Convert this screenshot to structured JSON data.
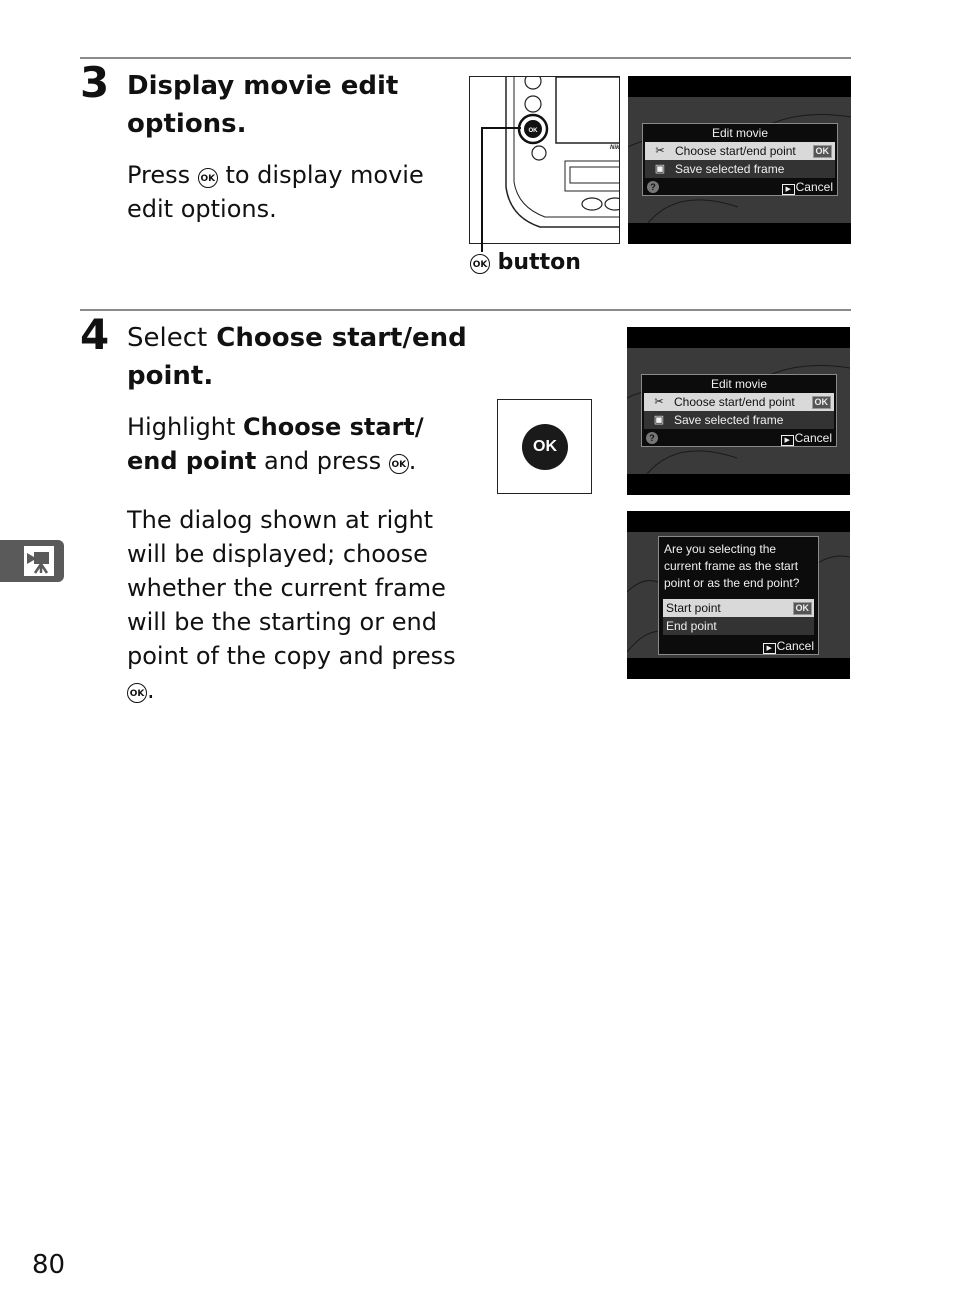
{
  "steps": [
    {
      "number": "3",
      "title": "Display movie edit options.",
      "body": {
        "before": "Press",
        "ok_symbol": "OK",
        "after": "to display movie edit options."
      },
      "figure_callout": {
        "ok_symbol": "OK",
        "label": "button"
      },
      "screen": {
        "title": "Edit movie",
        "items": [
          {
            "icon": "scissors-icon",
            "label": "Choose start/end point",
            "selected": true,
            "badge": "OK"
          },
          {
            "icon": "save-frame-icon",
            "label": "Save selected frame",
            "selected": false
          }
        ],
        "help": "?",
        "cancel": "Cancel"
      }
    },
    {
      "number": "4",
      "title_plain": "Select",
      "title_bold": "Choose start/end point",
      "title_end": ".",
      "para1": {
        "before": "Highlight",
        "bold": "Choose start/ end point",
        "after": "and press",
        "ok_symbol": "OK",
        "end": "."
      },
      "para2": {
        "text": "The dialog shown at right will be displayed; choose whether the current frame will be the starting or end point of the copy and press",
        "ok_symbol": "OK",
        "end": "."
      },
      "ok_button_graphic": "OK",
      "screen1": {
        "title": "Edit movie",
        "items": [
          {
            "icon": "scissors-icon",
            "label": "Choose start/end point",
            "selected": true,
            "badge": "OK"
          },
          {
            "icon": "save-frame-icon",
            "label": "Save selected frame",
            "selected": false
          }
        ],
        "help": "?",
        "cancel": "Cancel"
      },
      "screen2": {
        "question": "Are you selecting the current frame as the start point or as the end point?",
        "options": [
          {
            "label": "Start point",
            "selected": true,
            "badge": "OK"
          },
          {
            "label": "End point",
            "selected": false
          }
        ],
        "cancel": "Cancel"
      }
    }
  ],
  "side_tab": {
    "icon": "movie-camera-icon"
  },
  "page_number": "80",
  "colors": {
    "rule": "#8a8a8a",
    "side_tab": "#5a5a5a",
    "menu_highlight": "#d9d9d9"
  }
}
